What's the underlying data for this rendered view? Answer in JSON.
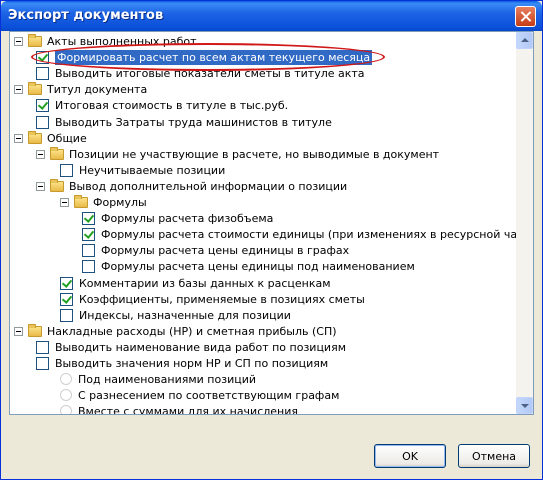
{
  "window": {
    "title": "Экспорт документов"
  },
  "tree": {
    "items": [
      {
        "type": "folder",
        "label": "Акты выполненных работ"
      },
      {
        "type": "checkbox",
        "checked": true,
        "selected": true,
        "label": "Формировать расчет по всем актам текущего месяца"
      },
      {
        "type": "checkbox",
        "checked": false,
        "label": "Выводить итоговые показатели сметы в титуле акта"
      },
      {
        "type": "folder",
        "label": "Титул документа"
      },
      {
        "type": "checkbox",
        "checked": true,
        "label": "Итоговая стоимость в титуле в тыс.руб."
      },
      {
        "type": "checkbox",
        "checked": false,
        "label": "Выводить Затраты труда машинистов в титуле"
      },
      {
        "type": "folder",
        "label": "Общие"
      },
      {
        "type": "folder",
        "label": "Позиции не участвующие в расчете, но выводимые в документ"
      },
      {
        "type": "checkbox",
        "checked": false,
        "label": "Неучитываемые позиции"
      },
      {
        "type": "folder",
        "label": "Вывод дополнительной информации о позиции"
      },
      {
        "type": "folder",
        "label": "Формулы"
      },
      {
        "type": "checkbox",
        "checked": true,
        "label": "Формулы расчета физобъема"
      },
      {
        "type": "checkbox",
        "checked": true,
        "label": "Формулы расчета стоимости единицы (при изменениях в ресурсной части)"
      },
      {
        "type": "checkbox",
        "checked": false,
        "label": "Формулы расчета цены единицы в графах"
      },
      {
        "type": "checkbox",
        "checked": false,
        "label": "Формулы расчета цены единицы под наименованием"
      },
      {
        "type": "checkbox",
        "checked": true,
        "label": "Комментарии из базы данных к расценкам"
      },
      {
        "type": "checkbox",
        "checked": true,
        "label": "Коэффициенты, применяемые в позициях сметы"
      },
      {
        "type": "checkbox",
        "checked": false,
        "label": "Индексы, назначенные для позиции"
      },
      {
        "type": "folder",
        "label": "Накладные расходы (НР) и сметная прибыль (СП)"
      },
      {
        "type": "checkbox",
        "checked": false,
        "label": "Выводить наименование вида работ по позициям"
      },
      {
        "type": "checkbox",
        "checked": false,
        "label": "Выводить значения норм НР и СП по позициям"
      },
      {
        "type": "radio",
        "label": "Под наименованиями позиций"
      },
      {
        "type": "radio",
        "label": "С разнесением по соответствующим графам"
      },
      {
        "type": "radio",
        "label": "Вместе с суммами для их начисления"
      }
    ]
  },
  "buttons": {
    "ok": "OK",
    "cancel": "Отмена"
  }
}
